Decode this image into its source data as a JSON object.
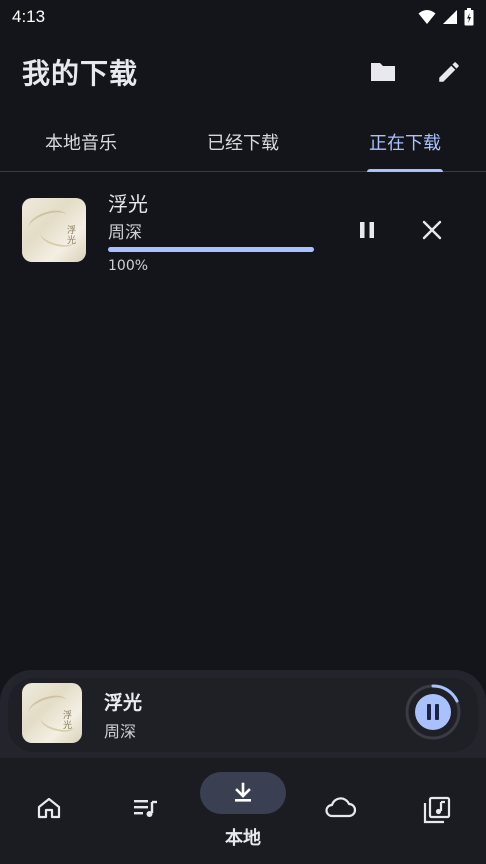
{
  "status_bar": {
    "time": "4:13"
  },
  "app_bar": {
    "title": "我的下载",
    "icons": [
      "folder-icon",
      "edit-icon"
    ]
  },
  "tabs": [
    {
      "label": "本地音乐",
      "active": false
    },
    {
      "label": "已经下载",
      "active": false
    },
    {
      "label": "正在下载",
      "active": true
    }
  ],
  "download": {
    "title": "浮光",
    "artist": "周深",
    "progress": 1.0,
    "progress_label": "100%"
  },
  "mini_player": {
    "title": "浮光",
    "artist": "周深",
    "state": "playing"
  },
  "bottom_nav": [
    {
      "icon": "home-icon",
      "label": "",
      "active": false
    },
    {
      "icon": "playlist-icon",
      "label": "",
      "active": false
    },
    {
      "icon": "download-icon",
      "label": "本地",
      "active": true
    },
    {
      "icon": "cloud-icon",
      "label": "",
      "active": false
    },
    {
      "icon": "music-library-icon",
      "label": "",
      "active": false
    }
  ],
  "colors": {
    "background": "#14151a",
    "accent": "#a9c2ff",
    "nav_pill": "#3a3f52"
  }
}
